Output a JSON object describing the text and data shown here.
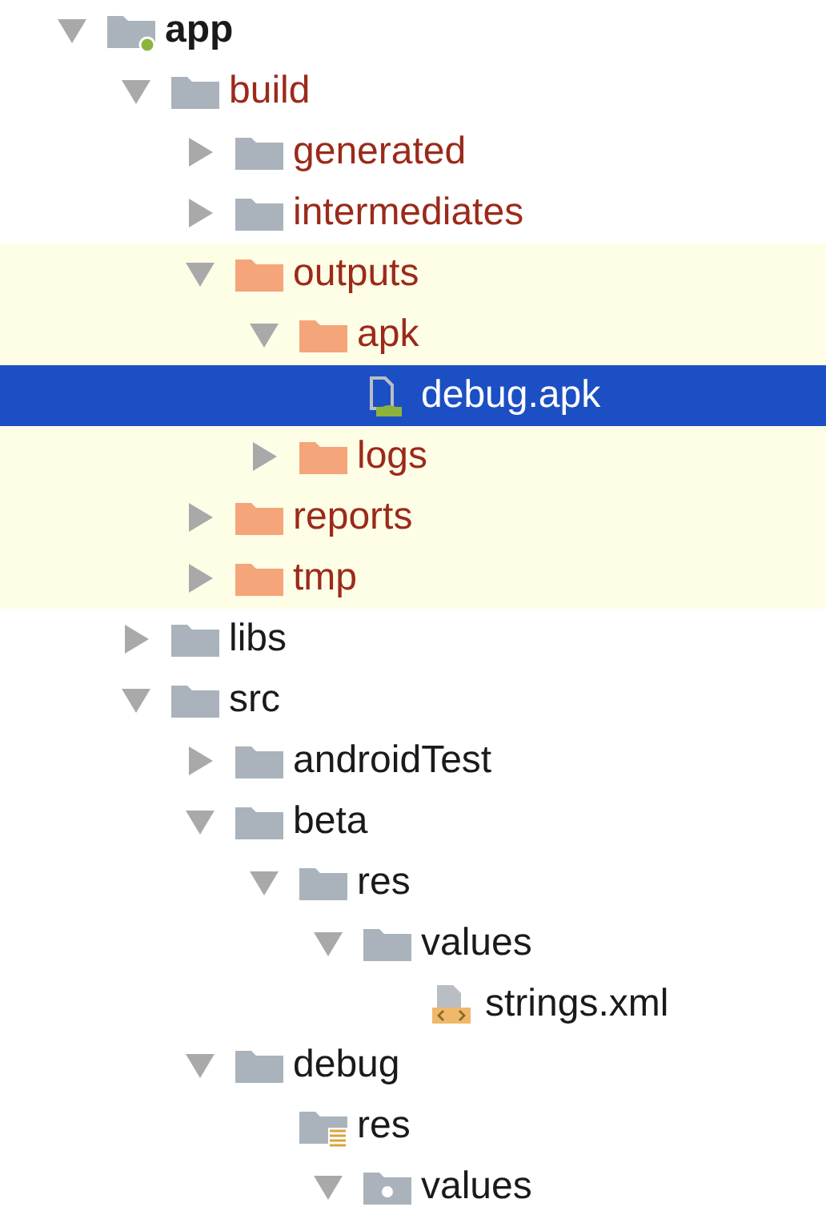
{
  "tree": [
    {
      "label": "app",
      "kind": "module",
      "expanded": true,
      "excluded": false,
      "highlighted": false,
      "selected": false,
      "children": [
        {
          "label": "build",
          "kind": "folder",
          "expanded": true,
          "excluded": true,
          "highlighted": false,
          "selected": false,
          "children": [
            {
              "label": "generated",
              "kind": "folder",
              "expanded": false,
              "excluded": true,
              "highlighted": false,
              "selected": false
            },
            {
              "label": "intermediates",
              "kind": "folder",
              "expanded": false,
              "excluded": true,
              "highlighted": false,
              "selected": false
            },
            {
              "label": "outputs",
              "kind": "output-folder",
              "expanded": true,
              "excluded": true,
              "highlighted": true,
              "selected": false,
              "children": [
                {
                  "label": "apk",
                  "kind": "output-folder",
                  "expanded": true,
                  "excluded": true,
                  "highlighted": true,
                  "selected": false,
                  "children": [
                    {
                      "label": "debug.apk",
                      "kind": "apk",
                      "selected": true
                    }
                  ]
                },
                {
                  "label": "logs",
                  "kind": "output-folder",
                  "expanded": false,
                  "excluded": true,
                  "highlighted": true,
                  "selected": false
                }
              ]
            },
            {
              "label": "reports",
              "kind": "output-folder",
              "expanded": false,
              "excluded": true,
              "highlighted": true,
              "selected": false
            },
            {
              "label": "tmp",
              "kind": "output-folder",
              "expanded": false,
              "excluded": true,
              "highlighted": true,
              "selected": false
            }
          ]
        },
        {
          "label": "libs",
          "kind": "folder",
          "expanded": false,
          "excluded": false,
          "highlighted": false,
          "selected": false
        },
        {
          "label": "src",
          "kind": "folder",
          "expanded": true,
          "excluded": false,
          "highlighted": false,
          "selected": false,
          "children": [
            {
              "label": "androidTest",
              "kind": "folder",
              "expanded": false,
              "excluded": false,
              "highlighted": false,
              "selected": false
            },
            {
              "label": "beta",
              "kind": "folder",
              "expanded": true,
              "excluded": false,
              "highlighted": false,
              "selected": false,
              "children": [
                {
                  "label": "res",
                  "kind": "folder",
                  "expanded": true,
                  "excluded": false,
                  "highlighted": false,
                  "selected": false,
                  "children": [
                    {
                      "label": "values",
                      "kind": "folder",
                      "expanded": true,
                      "excluded": false,
                      "highlighted": false,
                      "selected": false,
                      "children": [
                        {
                          "label": "strings.xml",
                          "kind": "xml",
                          "excluded": false,
                          "highlighted": false,
                          "selected": false
                        }
                      ]
                    }
                  ]
                }
              ]
            },
            {
              "label": "debug",
              "kind": "folder",
              "expanded": true,
              "excluded": false,
              "highlighted": false,
              "selected": false,
              "children": [
                {
                  "label": "res",
                  "kind": "res-folder",
                  "excluded": false,
                  "highlighted": false,
                  "selected": false,
                  "children": [
                    {
                      "label": "values",
                      "kind": "values-folder",
                      "expanded": true,
                      "excluded": false,
                      "highlighted": false,
                      "selected": false
                    }
                  ]
                }
              ]
            }
          ]
        }
      ]
    }
  ]
}
